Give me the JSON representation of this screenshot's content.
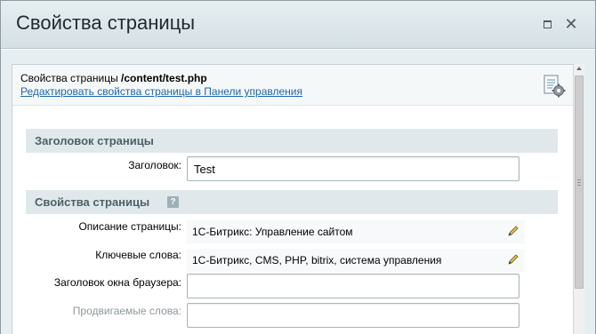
{
  "window": {
    "title": "Свойства страницы",
    "controls": {
      "maximize_icon": "maximize-icon",
      "close_icon": "close-icon",
      "close_glyph": "✕"
    }
  },
  "info": {
    "title_prefix": "Свойства страницы ",
    "path": "/content/test.php",
    "link": "Редактировать свойства страницы в Панели управления",
    "icon": "page-settings-icon"
  },
  "sections": {
    "header": {
      "label": "Заголовок страницы"
    },
    "properties": {
      "label": "Свойства страницы",
      "help_glyph": "?"
    }
  },
  "fields": {
    "title": {
      "label": "Заголовок:",
      "value": "Test"
    },
    "description": {
      "label": "Описание страницы:",
      "value": "1С-Битрикс: Управление сайтом"
    },
    "keywords": {
      "label": "Ключевые слова:",
      "value": "1С-Битрикс, CMS, PHP, bitrix, система управления"
    },
    "browser_title": {
      "label": "Заголовок окна браузера:",
      "value": ""
    },
    "promoted_words": {
      "label": "Продвигаемые слова:",
      "value": ""
    }
  },
  "colors": {
    "titlebar": "#dde6ea",
    "section_bg": "#e0e8eb",
    "section_text": "#4b6269",
    "link": "#2167a6"
  }
}
